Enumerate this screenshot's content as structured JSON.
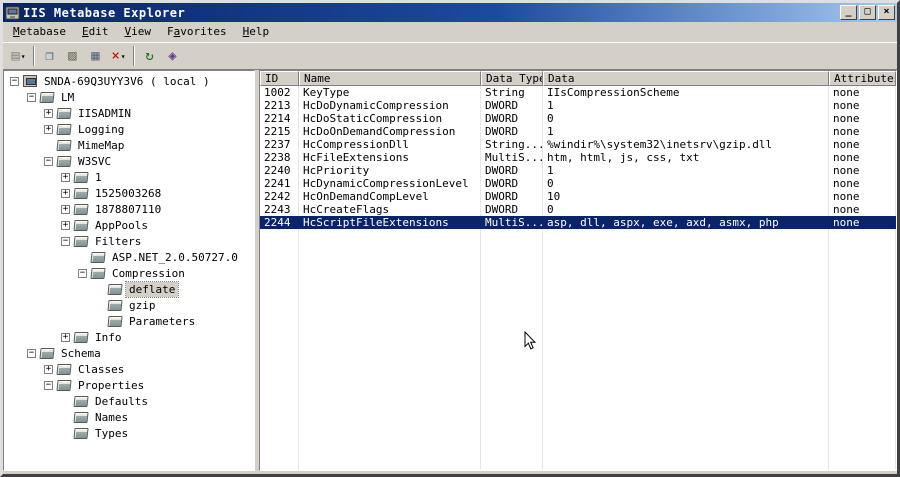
{
  "window": {
    "title": "IIS Metabase Explorer",
    "controls": {
      "minimize": "_",
      "maximize": "□",
      "close": "×"
    }
  },
  "menu": {
    "items": [
      {
        "label": "Metabase",
        "u": 0
      },
      {
        "label": "Edit",
        "u": 0
      },
      {
        "label": "View",
        "u": 0
      },
      {
        "label": "Favorites",
        "u": 1
      },
      {
        "label": "Help",
        "u": 0
      }
    ]
  },
  "toolbar": {
    "items": [
      {
        "type": "button",
        "name": "new-item-button",
        "icon": "new-key-icon",
        "glyph": "▤",
        "color": "#8a8a7a",
        "dropdown": true
      },
      {
        "type": "separator"
      },
      {
        "type": "button",
        "name": "copy-button",
        "icon": "copy-icon",
        "glyph": "❐",
        "color": "#3a5a8a"
      },
      {
        "type": "button",
        "name": "paste-button",
        "icon": "paste-icon",
        "glyph": "▨",
        "color": "#6a6a5a"
      },
      {
        "type": "button",
        "name": "properties-button",
        "icon": "properties-icon",
        "glyph": "▦",
        "color": "#5a6a7a"
      },
      {
        "type": "button",
        "name": "delete-button",
        "icon": "delete-x-icon",
        "glyph": "×",
        "color": "#c00000",
        "dropdown": true
      },
      {
        "type": "separator"
      },
      {
        "type": "button",
        "name": "refresh-button",
        "icon": "refresh-icon",
        "glyph": "↻",
        "color": "#0a7a0a"
      },
      {
        "type": "button",
        "name": "network-button",
        "icon": "network-nodes-icon",
        "glyph": "◈",
        "color": "#5a3a8a"
      }
    ]
  },
  "tree": {
    "items": [
      {
        "label": "SNDA-69Q3UYY3V6 ( local )",
        "depth": 0,
        "expander": "minus",
        "icon": "computer",
        "selected": false
      },
      {
        "label": "LM",
        "depth": 1,
        "expander": "minus",
        "icon": "node",
        "selected": false
      },
      {
        "label": "IISADMIN",
        "depth": 2,
        "expander": "plus",
        "icon": "node",
        "selected": false
      },
      {
        "label": "Logging",
        "depth": 2,
        "expander": "plus",
        "icon": "node",
        "selected": false
      },
      {
        "label": "MimeMap",
        "depth": 2,
        "expander": "none",
        "icon": "node",
        "selected": false
      },
      {
        "label": "W3SVC",
        "depth": 2,
        "expander": "minus",
        "icon": "node",
        "selected": false
      },
      {
        "label": "1",
        "depth": 3,
        "expander": "plus",
        "icon": "node",
        "selected": false
      },
      {
        "label": "1525003268",
        "depth": 3,
        "expander": "plus",
        "icon": "node",
        "selected": false
      },
      {
        "label": "1878807110",
        "depth": 3,
        "expander": "plus",
        "icon": "node",
        "selected": false
      },
      {
        "label": "AppPools",
        "depth": 3,
        "expander": "plus",
        "icon": "node",
        "selected": false
      },
      {
        "label": "Filters",
        "depth": 3,
        "expander": "minus",
        "icon": "node",
        "selected": false
      },
      {
        "label": "ASP.NET_2.0.50727.0",
        "depth": 4,
        "expander": "none",
        "icon": "node",
        "selected": false
      },
      {
        "label": "Compression",
        "depth": 4,
        "expander": "minus",
        "icon": "node",
        "selected": false
      },
      {
        "label": "deflate",
        "depth": 5,
        "expander": "none",
        "icon": "node",
        "selected": true
      },
      {
        "label": "gzip",
        "depth": 5,
        "expander": "none",
        "icon": "node",
        "selected": false
      },
      {
        "label": "Parameters",
        "depth": 5,
        "expander": "none",
        "icon": "node",
        "selected": false
      },
      {
        "label": "Info",
        "depth": 3,
        "expander": "plus",
        "icon": "node",
        "selected": false
      },
      {
        "label": "Schema",
        "depth": 1,
        "expander": "minus",
        "icon": "node",
        "selected": false
      },
      {
        "label": "Classes",
        "depth": 2,
        "expander": "plus",
        "icon": "node",
        "selected": false
      },
      {
        "label": "Properties",
        "depth": 2,
        "expander": "minus",
        "icon": "node",
        "selected": false
      },
      {
        "label": "Defaults",
        "depth": 3,
        "expander": "none",
        "icon": "node",
        "selected": false
      },
      {
        "label": "Names",
        "depth": 3,
        "expander": "none",
        "icon": "node",
        "selected": false
      },
      {
        "label": "Types",
        "depth": 3,
        "expander": "none",
        "icon": "node",
        "selected": false
      }
    ]
  },
  "table": {
    "columns": [
      "ID",
      "Name",
      "Data Type",
      "Data",
      "Attributes"
    ],
    "rows": [
      {
        "id": "1002",
        "name": "KeyType",
        "data_type": "String",
        "data": "IIsCompressionScheme",
        "attributes": "none",
        "selected": false
      },
      {
        "id": "2213",
        "name": "HcDoDynamicCompression",
        "data_type": "DWORD",
        "data": "1",
        "attributes": "none",
        "selected": false
      },
      {
        "id": "2214",
        "name": "HcDoStaticCompression",
        "data_type": "DWORD",
        "data": "0",
        "attributes": "none",
        "selected": false
      },
      {
        "id": "2215",
        "name": "HcDoOnDemandCompression",
        "data_type": "DWORD",
        "data": "1",
        "attributes": "none",
        "selected": false
      },
      {
        "id": "2237",
        "name": "HcCompressionDll",
        "data_type": "String...",
        "data": "%windir%\\system32\\inetsrv\\gzip.dll",
        "attributes": "none",
        "selected": false
      },
      {
        "id": "2238",
        "name": "HcFileExtensions",
        "data_type": "MultiS...",
        "data": "htm, html, js, css, txt",
        "attributes": "none",
        "selected": false
      },
      {
        "id": "2240",
        "name": "HcPriority",
        "data_type": "DWORD",
        "data": "1",
        "attributes": "none",
        "selected": false
      },
      {
        "id": "2241",
        "name": "HcDynamicCompressionLevel",
        "data_type": "DWORD",
        "data": "0",
        "attributes": "none",
        "selected": false
      },
      {
        "id": "2242",
        "name": "HcOnDemandCompLevel",
        "data_type": "DWORD",
        "data": "10",
        "attributes": "none",
        "selected": false
      },
      {
        "id": "2243",
        "name": "HcCreateFlags",
        "data_type": "DWORD",
        "data": "0",
        "attributes": "none",
        "selected": false
      },
      {
        "id": "2244",
        "name": "HcScriptFileExtensions",
        "data_type": "MultiS...",
        "data": "asp, dll, aspx, exe, axd, asmx, php",
        "attributes": "none",
        "selected": true
      }
    ]
  },
  "colors": {
    "titlebar_start": "#0a246a",
    "titlebar_end": "#a6caf0",
    "chrome": "#d4d0c8",
    "selection": "#0a246a"
  }
}
